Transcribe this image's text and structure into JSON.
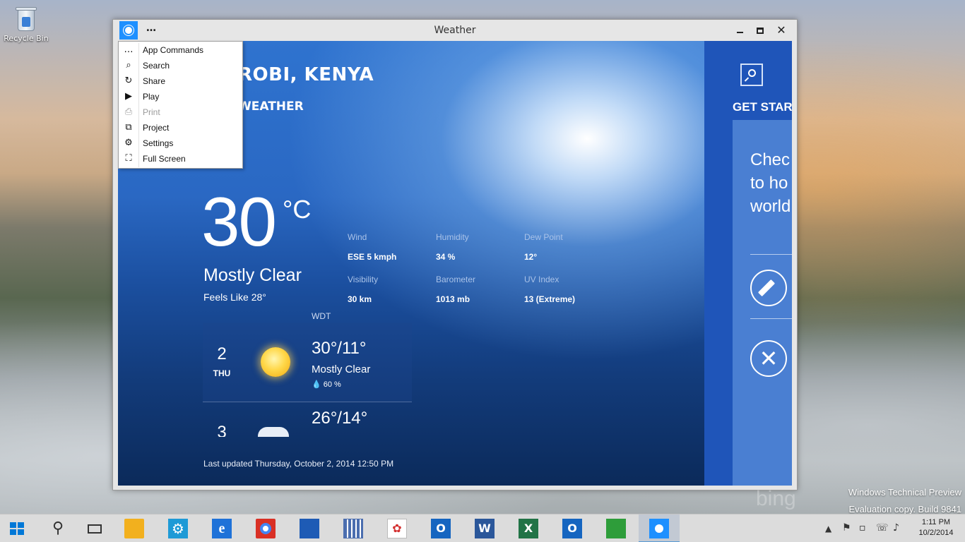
{
  "desktop": {
    "icons": [
      {
        "label": "Recycle Bin",
        "icon": "recycle-bin-icon"
      }
    ],
    "watermark": {
      "line1": "Windows Technical Preview",
      "line2": "Evaluation copy. Build 9841"
    },
    "bing_text": "bing"
  },
  "window": {
    "title": "Weather",
    "app_commands_glyph": "…",
    "controls": {
      "minimize": "minimize-icon",
      "maximize": "maximize-icon",
      "close_glyph": "✕"
    }
  },
  "menu": {
    "items": [
      {
        "label": "App Commands",
        "icon": "more-icon",
        "glyph": "…",
        "enabled": true
      },
      {
        "label": "Search",
        "icon": "search-icon",
        "glyph": "⌕",
        "enabled": true
      },
      {
        "label": "Share",
        "icon": "share-icon",
        "glyph": "↻",
        "enabled": true
      },
      {
        "label": "Play",
        "icon": "play-icon",
        "glyph": "▶",
        "enabled": true
      },
      {
        "label": "Print",
        "icon": "print-icon",
        "glyph": "⎙",
        "enabled": false
      },
      {
        "label": "Project",
        "icon": "project-icon",
        "glyph": "⧉",
        "enabled": true
      },
      {
        "label": "Settings",
        "icon": "gear-icon",
        "glyph": "⚙",
        "enabled": true
      },
      {
        "label": "Full Screen",
        "icon": "fullscreen-icon",
        "glyph": "⛶",
        "enabled": true
      }
    ]
  },
  "weather": {
    "city": "ROBI, KENYA",
    "subtitle": "WEATHER",
    "temperature": "30",
    "unit": "°C",
    "condition": "Mostly Clear",
    "feels_like": "Feels Like 28°",
    "stats": [
      {
        "label": "Wind",
        "value": "ESE 5 kmph"
      },
      {
        "label": "Humidity",
        "value": "34 %"
      },
      {
        "label": "Dew Point",
        "value": "12°"
      },
      {
        "label": "Visibility",
        "value": "30 km"
      },
      {
        "label": "Barometer",
        "value": "1013 mb"
      },
      {
        "label": "UV Index",
        "value": "13 (Extreme)"
      }
    ],
    "forecast_source": "WDT",
    "forecast": [
      {
        "day_num": "2",
        "day_name": "THU",
        "hilo": "30°/11°",
        "desc": "Mostly Clear",
        "precip": "💧 60 %",
        "icon": "sun-icon"
      },
      {
        "day_num": "3",
        "hilo": "26°/14°",
        "icon": "partly-cloudy-icon"
      }
    ],
    "last_updated": "Last updated Thursday, October 2, 2014 12:50 PM"
  },
  "panel": {
    "heading": "GET STAR",
    "card_lines": [
      "Chec",
      "to ho",
      "world"
    ],
    "edit_icon": "pencil-icon",
    "close_glyph": "✕"
  },
  "taskbar": {
    "buttons": [
      {
        "name": "start-button",
        "icon": "windows-logo-icon",
        "color": "#0078d7"
      },
      {
        "name": "search-button",
        "icon": "search-icon",
        "color": "#333333"
      },
      {
        "name": "task-view-button",
        "icon": "task-view-icon",
        "color": "#333333"
      },
      {
        "name": "file-explorer-button",
        "icon": "folder-icon",
        "color": "#f2b01e"
      },
      {
        "name": "settings-app-button",
        "icon": "gear-icon",
        "color": "#1e9ad6"
      },
      {
        "name": "internet-explorer-button",
        "icon": "ie-icon",
        "color": "#1f72d8"
      },
      {
        "name": "chrome-button",
        "icon": "chrome-icon",
        "color": "#d93025"
      },
      {
        "name": "app-button-1",
        "icon": "app-icon",
        "color": "#1e5bb5"
      },
      {
        "name": "app-button-2",
        "icon": "grid-app-icon",
        "color": "#4b6eaf"
      },
      {
        "name": "acrobat-button",
        "icon": "pdf-icon",
        "color": "#d32f2f"
      },
      {
        "name": "outlook-button",
        "icon": "outlook-icon",
        "color": "#1565c0"
      },
      {
        "name": "word-button",
        "icon": "word-icon",
        "color": "#2b579a"
      },
      {
        "name": "excel-button",
        "icon": "excel-icon",
        "color": "#217346"
      },
      {
        "name": "outlook-button-2",
        "icon": "outlook-icon",
        "color": "#1565c0"
      },
      {
        "name": "store-button",
        "icon": "store-icon",
        "color": "#2e9d3a"
      },
      {
        "name": "weather-app-button",
        "icon": "weather-sun-icon",
        "color": "#1e90ff",
        "active": true
      }
    ],
    "tray_icons": [
      "chevron-up-icon",
      "flag-icon",
      "devices-icon",
      "network-icon",
      "volume-icon"
    ],
    "tray_glyphs": [
      "▲",
      "⚑",
      "▫",
      "☏",
      "♪"
    ],
    "time": "1:11 PM",
    "date": "10/2/2014"
  }
}
